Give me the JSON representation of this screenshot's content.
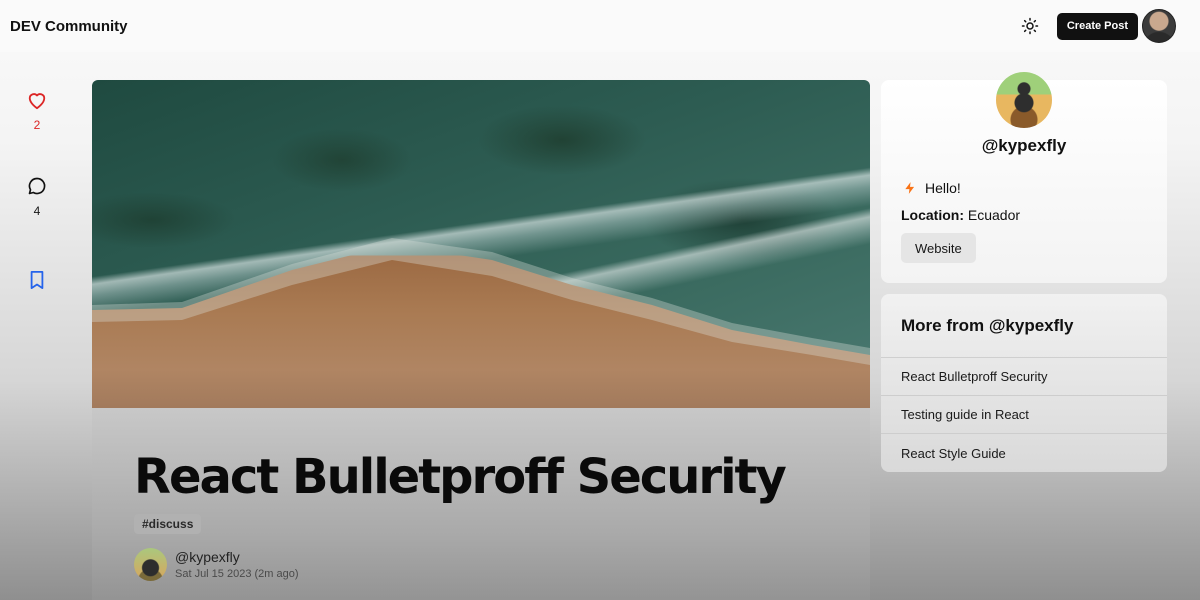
{
  "nav": {
    "brand": "DEV Community",
    "create_post_label": "Create Post"
  },
  "reactions": {
    "likes": "2",
    "comments": "4",
    "like_color": "#dc2626",
    "save_color": "#2563eb"
  },
  "article": {
    "title": "React Bulletproff Security",
    "tag": "#discuss",
    "author": "@kypexfly",
    "date": "Sat Jul 15 2023 (2m ago)"
  },
  "profile": {
    "handle": "@kypexfly",
    "bio": "Hello!",
    "location_label": "Location:",
    "location_value": " Ecuador",
    "website_label": "Website"
  },
  "more": {
    "title": "More from @kypexfly",
    "items": [
      "React Bulletproff Security",
      "Testing guide in React",
      "React Style Guide"
    ]
  },
  "icons": [
    "sun-icon",
    "heart-icon",
    "comment-icon",
    "bookmark-icon",
    "bolt-icon"
  ]
}
